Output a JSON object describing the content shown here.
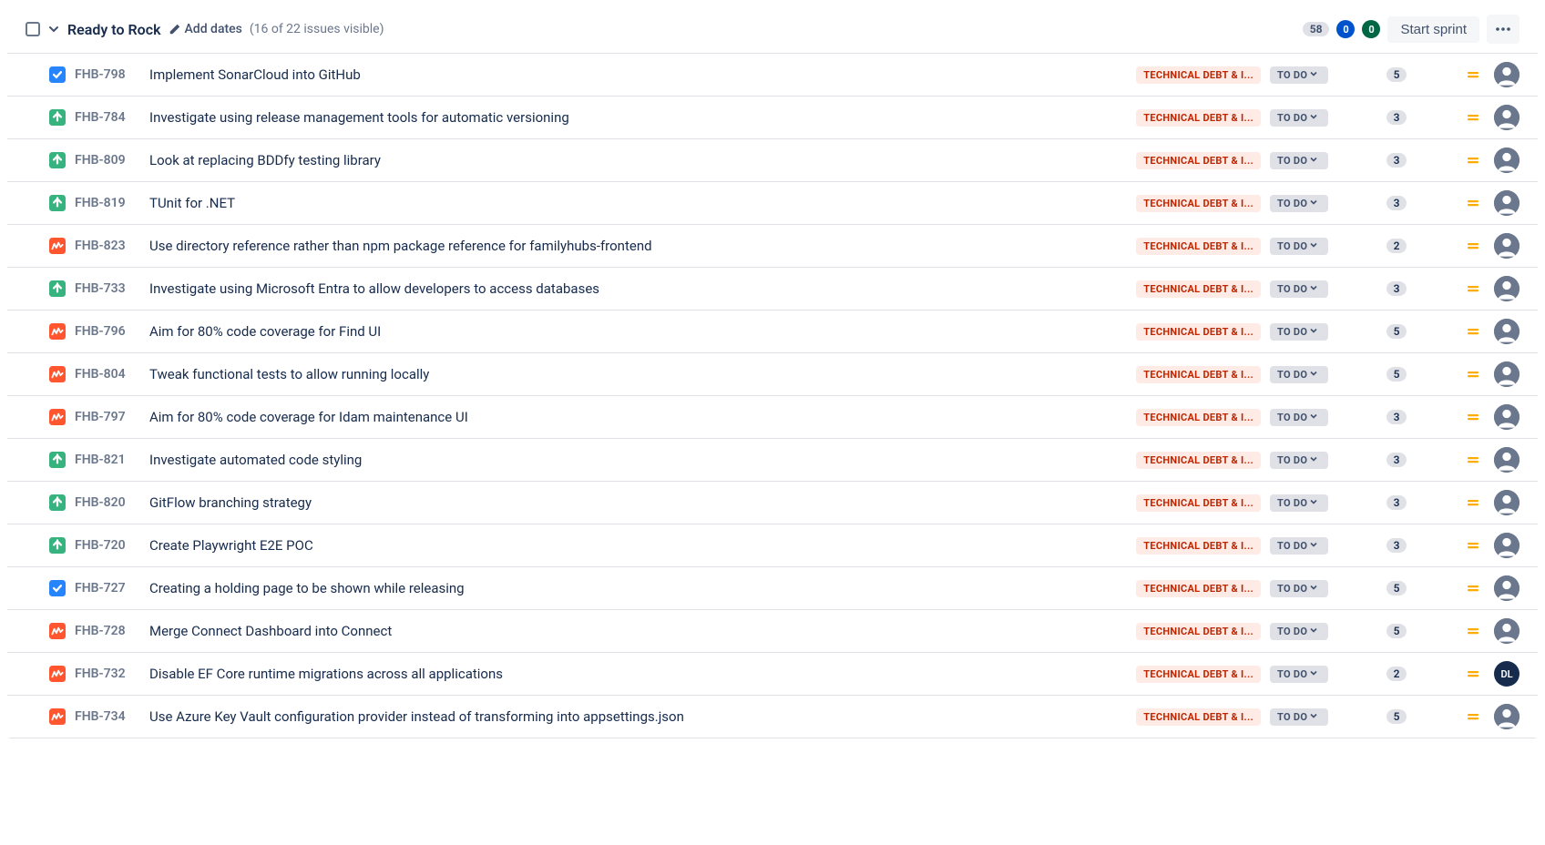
{
  "sprint": {
    "title": "Ready to Rock",
    "add_dates_label": "Add dates",
    "issues_count_label": "(16 of 22 issues visible)",
    "total_points": "58",
    "pill_blue": "0",
    "pill_green": "0",
    "start_sprint_label": "Start sprint"
  },
  "issues": [
    {
      "type": "task",
      "key": "FHB-798",
      "summary": "Implement SonarCloud into GitHub",
      "epic": "TECHNICAL DEBT & I...",
      "status": "TO DO",
      "points": "5",
      "priority": "medium",
      "assignee": "unassigned"
    },
    {
      "type": "story",
      "key": "FHB-784",
      "summary": "Investigate using release management tools for automatic versioning",
      "epic": "TECHNICAL DEBT & I...",
      "status": "TO DO",
      "points": "3",
      "priority": "medium",
      "assignee": "unassigned"
    },
    {
      "type": "story",
      "key": "FHB-809",
      "summary": "Look at replacing BDDfy testing library",
      "epic": "TECHNICAL DEBT & I...",
      "status": "TO DO",
      "points": "3",
      "priority": "medium",
      "assignee": "unassigned"
    },
    {
      "type": "story",
      "key": "FHB-819",
      "summary": "TUnit for .NET",
      "epic": "TECHNICAL DEBT & I...",
      "status": "TO DO",
      "points": "3",
      "priority": "medium",
      "assignee": "unassigned"
    },
    {
      "type": "bug",
      "key": "FHB-823",
      "summary": "Use directory reference rather than npm package reference for familyhubs-frontend",
      "epic": "TECHNICAL DEBT & I...",
      "status": "TO DO",
      "points": "2",
      "priority": "medium",
      "assignee": "unassigned"
    },
    {
      "type": "story",
      "key": "FHB-733",
      "summary": "Investigate using Microsoft Entra to allow developers to access databases",
      "epic": "TECHNICAL DEBT & I...",
      "status": "TO DO",
      "points": "3",
      "priority": "medium",
      "assignee": "unassigned"
    },
    {
      "type": "bug",
      "key": "FHB-796",
      "summary": "Aim for 80% code coverage for Find UI",
      "epic": "TECHNICAL DEBT & I...",
      "status": "TO DO",
      "points": "5",
      "priority": "medium",
      "assignee": "unassigned"
    },
    {
      "type": "bug",
      "key": "FHB-804",
      "summary": "Tweak functional tests to allow running locally",
      "epic": "TECHNICAL DEBT & I...",
      "status": "TO DO",
      "points": "5",
      "priority": "medium",
      "assignee": "unassigned"
    },
    {
      "type": "bug",
      "key": "FHB-797",
      "summary": "Aim for 80% code coverage for Idam maintenance UI",
      "epic": "TECHNICAL DEBT & I...",
      "status": "TO DO",
      "points": "3",
      "priority": "medium",
      "assignee": "unassigned"
    },
    {
      "type": "story",
      "key": "FHB-821",
      "summary": "Investigate automated code styling",
      "epic": "TECHNICAL DEBT & I...",
      "status": "TO DO",
      "points": "3",
      "priority": "medium",
      "assignee": "unassigned"
    },
    {
      "type": "story",
      "key": "FHB-820",
      "summary": "GitFlow branching strategy",
      "epic": "TECHNICAL DEBT & I...",
      "status": "TO DO",
      "points": "3",
      "priority": "medium",
      "assignee": "unassigned"
    },
    {
      "type": "story",
      "key": "FHB-720",
      "summary": "Create Playwright E2E POC",
      "epic": "TECHNICAL DEBT & I...",
      "status": "TO DO",
      "points": "3",
      "priority": "medium",
      "assignee": "unassigned"
    },
    {
      "type": "task",
      "key": "FHB-727",
      "summary": "Creating a holding page to be shown while releasing",
      "epic": "TECHNICAL DEBT & I...",
      "status": "TO DO",
      "points": "5",
      "priority": "medium",
      "assignee": "unassigned"
    },
    {
      "type": "bug",
      "key": "FHB-728",
      "summary": "Merge Connect Dashboard into Connect",
      "epic": "TECHNICAL DEBT & I...",
      "status": "TO DO",
      "points": "5",
      "priority": "medium",
      "assignee": "unassigned"
    },
    {
      "type": "bug",
      "key": "FHB-732",
      "summary": "Disable EF Core runtime migrations across all applications",
      "epic": "TECHNICAL DEBT & I...",
      "status": "TO DO",
      "points": "2",
      "priority": "medium",
      "assignee": "DL"
    },
    {
      "type": "bug",
      "key": "FHB-734",
      "summary": "Use Azure Key Vault configuration provider instead of transforming into appsettings.json",
      "epic": "TECHNICAL DEBT & I...",
      "status": "TO DO",
      "points": "5",
      "priority": "medium",
      "assignee": "unassigned"
    }
  ]
}
